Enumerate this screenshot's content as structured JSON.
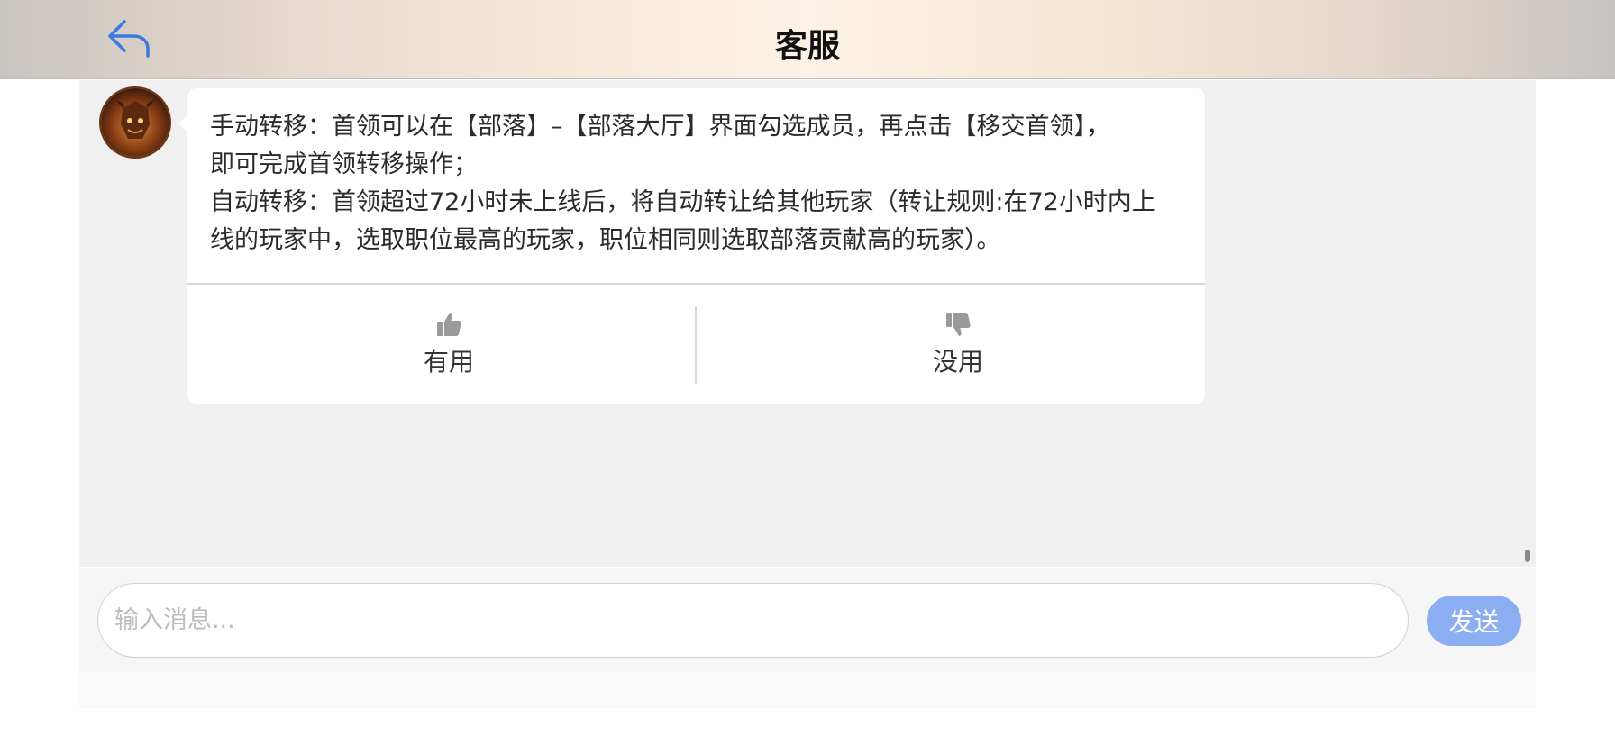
{
  "header": {
    "title": "客服",
    "back_icon": "back-arrow-icon",
    "accent_color": "#3a7be0"
  },
  "message": {
    "lines": [
      "手动转移：首领可以在【部落】–【部落大厅】界面勾选成员，再点击【移交首领】，",
      "即可完成首领转移操作；",
      "自动转移：首领超过72小时未上线后，将自动转让给其他玩家（转让规则:在72小时内上",
      "线的玩家中，选取职位最高的玩家，职位相同则选取部落贡献高的玩家）。"
    ]
  },
  "feedback": {
    "useful_label": "有用",
    "useless_label": "没用",
    "useful_icon": "thumbs-up-icon",
    "useless_icon": "thumbs-down-icon"
  },
  "composer": {
    "placeholder": "输入消息...",
    "value": "",
    "send_label": "发送",
    "send_color": "#8aaef1"
  }
}
